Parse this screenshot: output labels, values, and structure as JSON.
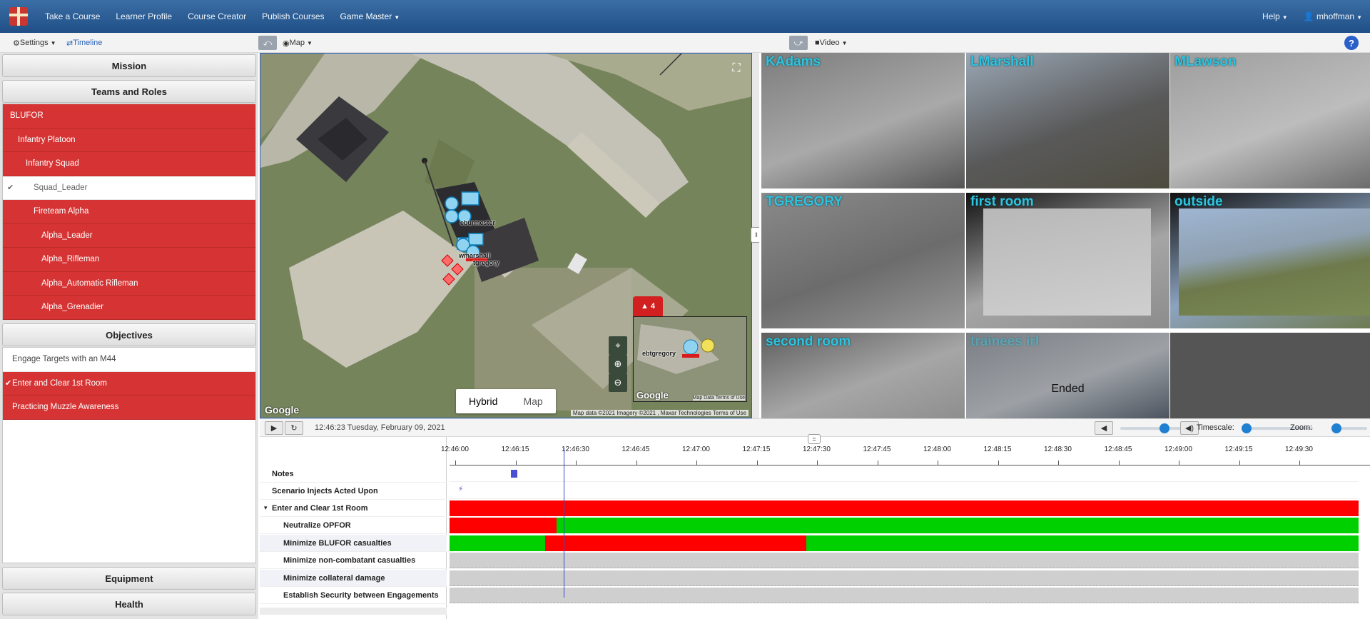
{
  "nav": {
    "items": [
      "Take a Course",
      "Learner Profile",
      "Course Creator",
      "Publish Courses",
      "Game Master"
    ],
    "help": "Help",
    "user": "mhoffman"
  },
  "toolbar": {
    "settings": "Settings",
    "timeline": "Timeline",
    "map": "Map",
    "video": "Video",
    "help": "?"
  },
  "left": {
    "mission": "Mission",
    "teams": "Teams and Roles",
    "tree": [
      {
        "label": "BLUFOR",
        "indent": 0,
        "state": "red"
      },
      {
        "label": "Infantry Platoon",
        "indent": 1,
        "state": "red"
      },
      {
        "label": "Infantry Squad",
        "indent": 2,
        "state": "red"
      },
      {
        "label": "Squad_Leader",
        "indent": 3,
        "state": "white",
        "check": true
      },
      {
        "label": "Fireteam Alpha",
        "indent": 3,
        "state": "red"
      },
      {
        "label": "Alpha_Leader",
        "indent": 4,
        "state": "red"
      },
      {
        "label": "Alpha_Rifleman",
        "indent": 4,
        "state": "red"
      },
      {
        "label": "Alpha_Automatic Rifleman",
        "indent": 4,
        "state": "red"
      },
      {
        "label": "Alpha_Grenadier",
        "indent": 4,
        "state": "red"
      }
    ],
    "objectives_title": "Objectives",
    "objectives": [
      {
        "label": "Engage Targets with an M44",
        "state": "white"
      },
      {
        "label": "Enter and Clear 1st Room",
        "state": "red",
        "check": true
      },
      {
        "label": "Practicing Muzzle Awareness",
        "state": "red"
      }
    ],
    "equipment": "Equipment",
    "health": "Health"
  },
  "map": {
    "labels": [
      "eburmester",
      "wmarshall",
      "tgregory"
    ],
    "minimap_label": "tgregory",
    "minimap_prefix": "eb",
    "alert_count": "4",
    "type_hybrid": "Hybrid",
    "type_map": "Map",
    "google": "Google",
    "minimap_google": "Google",
    "minimap_terms": "Map Data   Terms of Use",
    "credit": "Map data ©2021 Imagery ©2021 , Maxar Technologies    Terms of Use"
  },
  "videos": [
    {
      "label": "KAdams"
    },
    {
      "label": "LMarshall"
    },
    {
      "label": "MLawson"
    },
    {
      "label": "TGREGORY"
    },
    {
      "label": "first room"
    },
    {
      "label": "outside"
    },
    {
      "label": "second room"
    },
    {
      "label": "trainees irl",
      "status": "Ended"
    },
    {
      "label": ""
    }
  ],
  "transport": {
    "timestamp": "12:46:23 Tuesday, February 09, 2021",
    "timescale": "Timescale:",
    "zoom": "Zoom:",
    "volume_level": 0.72,
    "timescale_level": 0.0,
    "zoom_level": 0.0
  },
  "timeline": {
    "ticks": [
      "12:46:00",
      "12:46:15",
      "12:46:30",
      "12:46:45",
      "12:47:00",
      "12:47:15",
      "12:47:30",
      "12:47:45",
      "12:48:00",
      "12:48:15",
      "12:48:30",
      "12:48:45",
      "12:49:00",
      "12:49:15",
      "12:49:30"
    ],
    "rows": [
      {
        "label": "Notes",
        "indent": 0
      },
      {
        "label": "Scenario Injects Acted Upon",
        "indent": 0
      },
      {
        "label": "Enter and Clear 1st Room",
        "indent": 0,
        "expander": "▾"
      },
      {
        "label": "Neutralize OPFOR",
        "indent": 1
      },
      {
        "label": "Minimize BLUFOR casualties",
        "indent": 1
      },
      {
        "label": "Minimize non-combatant casualties",
        "indent": 1
      },
      {
        "label": "Minimize collateral damage",
        "indent": 1
      },
      {
        "label": "Establish Security between Engagements",
        "indent": 1
      }
    ]
  },
  "colors": {
    "red": "#d63434",
    "timeline_red": "#ff0000",
    "timeline_green": "#00d000",
    "video_label": "#2fc3e0",
    "nav_top": "#3b6ea5",
    "nav_bottom": "#1f4f86"
  }
}
